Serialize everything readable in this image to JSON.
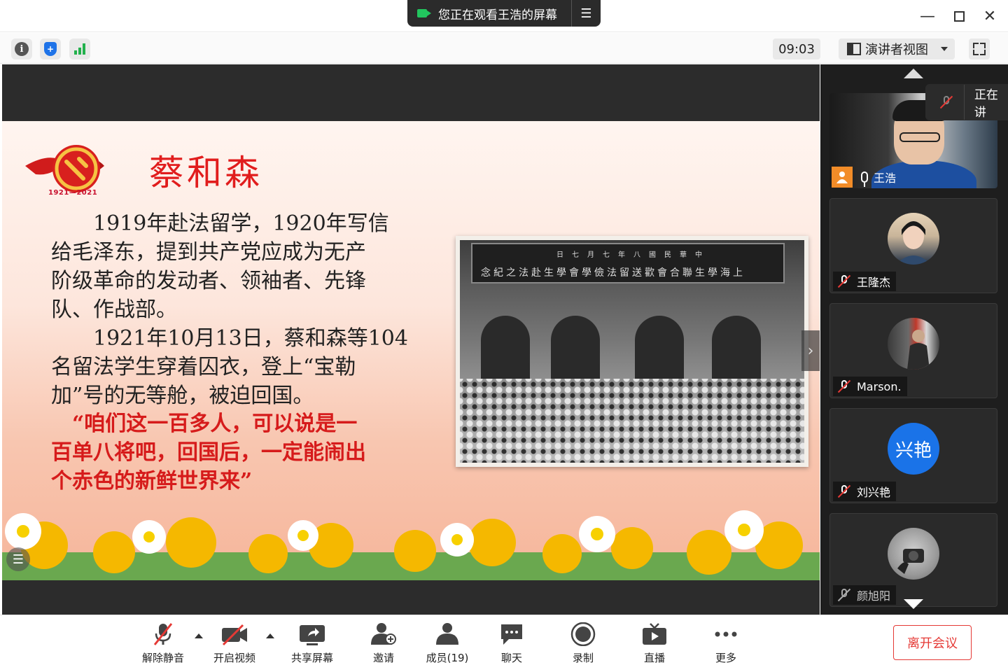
{
  "title_bar": {
    "sharing_banner": "您正在观看王浩的屏幕",
    "menu_icon": "list-menu-icon",
    "window_controls": [
      "minimize-icon",
      "maximize-icon",
      "close-icon"
    ]
  },
  "toolbar": {
    "icons": [
      "info-icon",
      "shield-icon",
      "signal-icon"
    ],
    "timer": "09:03",
    "view_mode": "演讲者视图",
    "fullscreen_icon": "fullscreen-icon"
  },
  "slide": {
    "emblem_year": "1921—2021",
    "title": "蔡和森",
    "para1_lines": [
      "　　1919年赴法留学，1920年写信",
      "给毛泽东，提到共产党应成为无产",
      "阶级革命的发动者、领袖者、先锋",
      "队、作战部。"
    ],
    "para2_lines": [
      "　　1921年10月13日，蔡和森等104",
      "名留法学生穿着囚衣，登上“宝勒",
      "加”号的无等舱，被迫回国。"
    ],
    "quote_lines": [
      "　“咱们这一百多人，可以说是一",
      "百单八将吧，回国后，一定能闹出",
      "个赤色的新鲜世界来”"
    ],
    "photo_banner_top": "日七月七年八國民華中",
    "photo_banner_main": "念紀之法赴生學會學儉法留送歡會合聯生學海上"
  },
  "panel": {
    "speaking_label": "正在讲",
    "live_participant": "王浩",
    "participants": [
      {
        "name": "王隆杰",
        "avatar_text": ""
      },
      {
        "name": "Marson.",
        "avatar_text": ""
      },
      {
        "name": "刘兴艳",
        "avatar_text": "兴艳",
        "avatar_color": "#1a73e8"
      },
      {
        "name": "颜旭阳",
        "avatar_text": ""
      }
    ]
  },
  "bottom_bar": {
    "unmute": "解除静音",
    "start_video": "开启视频",
    "share_screen": "共享屏幕",
    "invite": "邀请",
    "members": "成员(19)",
    "chat": "聊天",
    "record": "录制",
    "live": "直播",
    "more": "更多",
    "leave": "离开会议"
  }
}
